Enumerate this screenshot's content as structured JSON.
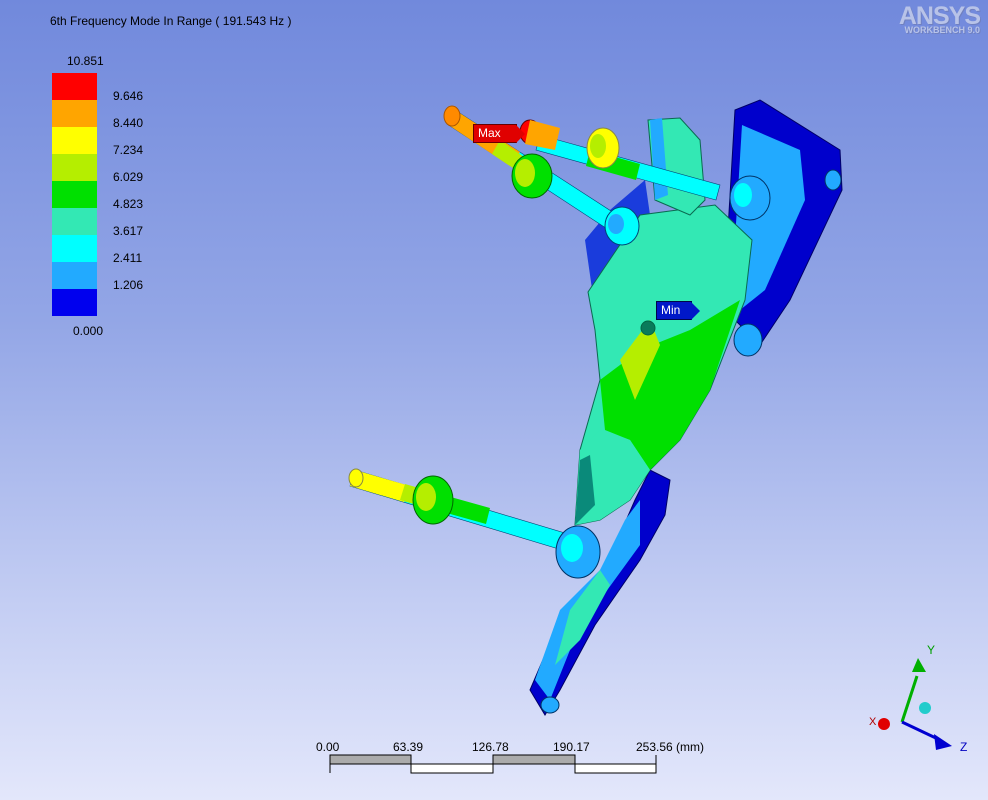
{
  "title": "6th Frequency Mode In Range ( 191.543 Hz )",
  "logo": {
    "brand": "ANSYS",
    "product": "WORKBENCH 9.0"
  },
  "legend": {
    "top_value": "10.851",
    "levels": [
      {
        "label": "9.646",
        "color": "#ff0000"
      },
      {
        "label": "8.440",
        "color": "#ffa500"
      },
      {
        "label": "7.234",
        "color": "#ffff00"
      },
      {
        "label": "6.029",
        "color": "#b5ee00"
      },
      {
        "label": "4.823",
        "color": "#00e000"
      },
      {
        "label": "3.617",
        "color": "#33e8b4"
      },
      {
        "label": "2.411",
        "color": "#00ffff"
      },
      {
        "label": "1.206",
        "color": "#22aaff"
      },
      {
        "label": "0.000",
        "color": "#0000ee"
      }
    ]
  },
  "probes": {
    "max_label": "Max",
    "min_label": "Min"
  },
  "scale_bar": {
    "ticks": [
      "0.00",
      "63.39",
      "126.78",
      "190.17",
      "253.56 (mm)"
    ]
  },
  "triad": {
    "y": "Y",
    "z": "Z",
    "x": "X"
  }
}
